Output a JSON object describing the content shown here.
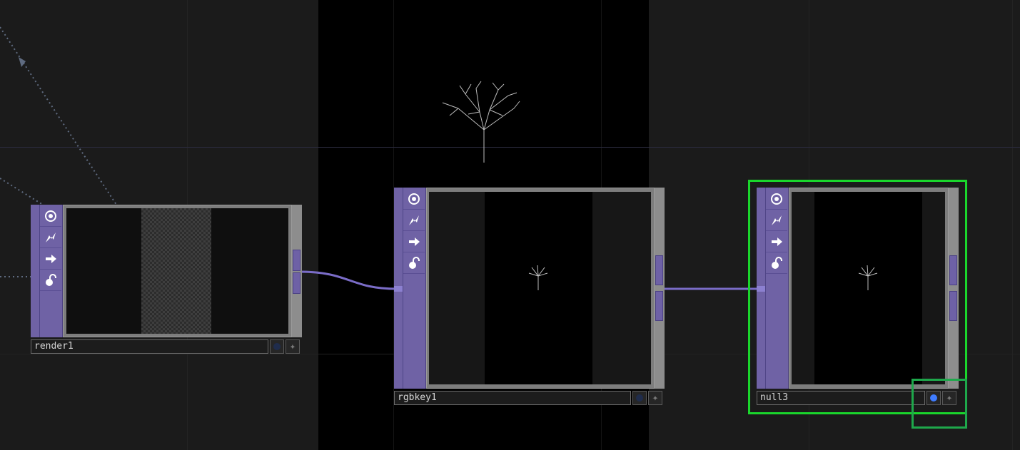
{
  "network": {
    "nodes": [
      {
        "name": "render1",
        "viewer_active": false
      },
      {
        "name": "rgbkey1",
        "viewer_active": false
      },
      {
        "name": "null3",
        "viewer_active": true,
        "selected": true
      }
    ]
  },
  "flags": [
    "bypass-icon",
    "lightning-icon",
    "arrow-right-icon",
    "lock-icon"
  ],
  "colors": {
    "node_strip": "#6f62a5",
    "wire": "#7a6cc7",
    "selection": "#1ad62c",
    "viewer_on": "#3f7cff"
  }
}
